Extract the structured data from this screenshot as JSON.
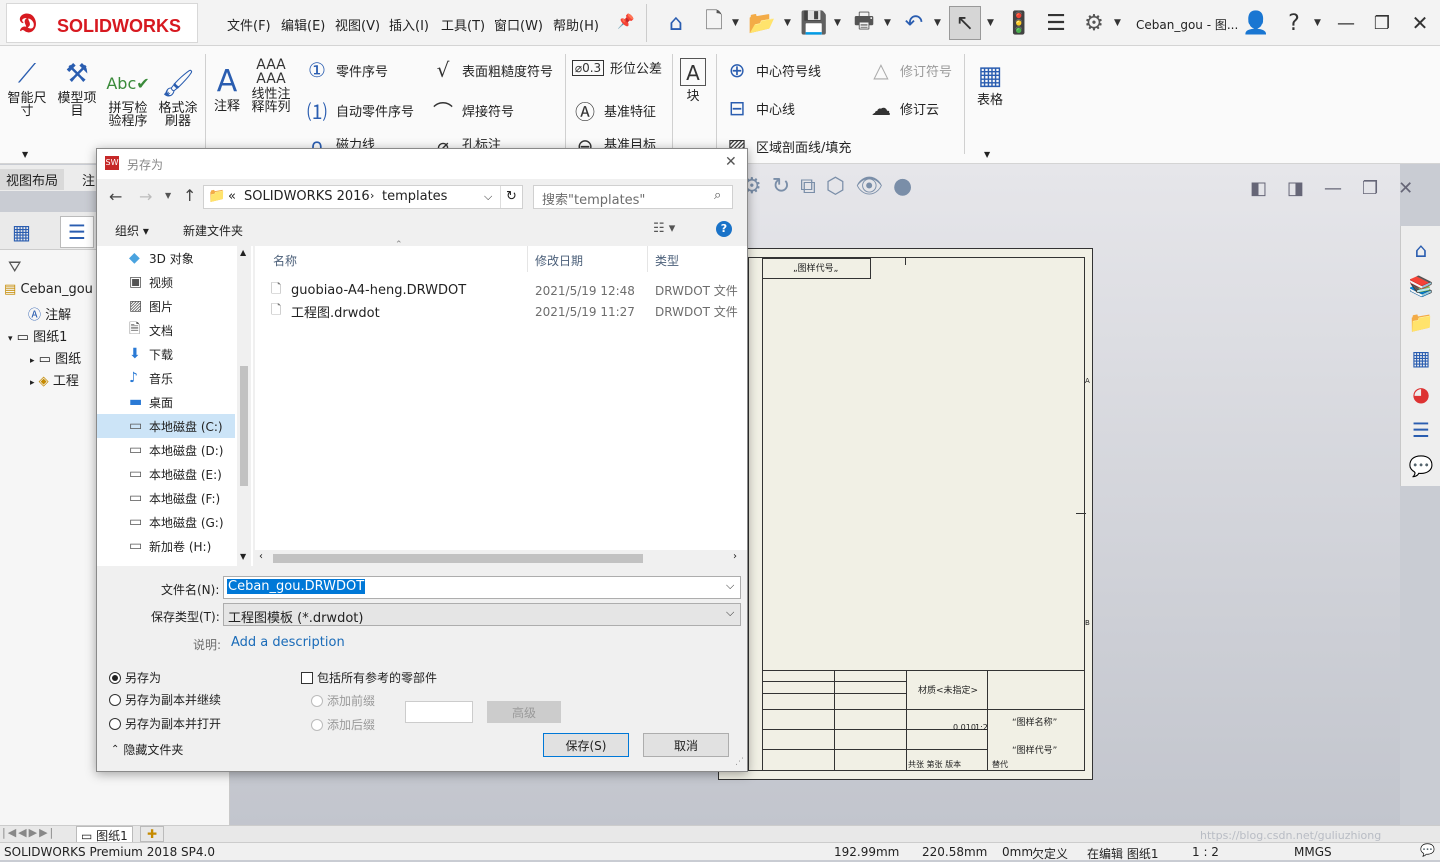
{
  "app": {
    "logo_text": "SOLIDWORKS",
    "window_title": "Ceban_gou - 图...",
    "menu": [
      "文件(F)",
      "编辑(E)",
      "视图(V)",
      "插入(I)",
      "工具(T)",
      "窗口(W)",
      "帮助(H)"
    ]
  },
  "ribbon": {
    "smart_dim": "智能尺寸",
    "model_items": "模型项目",
    "spell_check": "拼写检验程序",
    "format_painter": "格式涂刷器",
    "note": "注释",
    "linear_note": "线性注释阵列",
    "balloon": "零件序号",
    "auto_balloon": "自动零件序号",
    "magnetic_line": "磁力线",
    "surface_finish": "表面粗糙度符号",
    "weld_symbol": "焊接符号",
    "hole_callout": "孔标注",
    "gdt": "形位公差",
    "datum_feature": "基准特征",
    "datum_target": "基准目标",
    "block": "块",
    "centermark": "中心符号线",
    "centerline": "中心线",
    "area_hatch": "区域剖面线/填充",
    "revision_symbol": "修订符号",
    "revision_cloud": "修订云",
    "table": "表格"
  },
  "tabs": [
    "视图布局",
    "注"
  ],
  "tree": {
    "root": "Ceban_gou",
    "annotations": "注解",
    "sheet": "图纸1",
    "sheet_format": "图纸",
    "drawing_view": "工程"
  },
  "sheet": {
    "top_label": "„图样代号„",
    "material": "材质<未指定>",
    "drawing_name": "“图样名称”",
    "drawing_code": "“图样代号”",
    "scale_cells": [
      "0.010",
      "1:2"
    ],
    "zone_a": "A",
    "zone_b": "B",
    "signature_row": "共张 第张 版本",
    "rev_label": "替代"
  },
  "dialog": {
    "title": "另存为",
    "breadcrumb": [
      "SOLIDWORKS 2016",
      "templates"
    ],
    "search_placeholder": "搜索\"templates\"",
    "organize": "组织",
    "new_folder": "新建文件夹",
    "nav_items": [
      "3D 对象",
      "视频",
      "图片",
      "文档",
      "下载",
      "音乐",
      "桌面",
      "本地磁盘 (C:)",
      "本地磁盘 (D:)",
      "本地磁盘 (E:)",
      "本地磁盘 (F:)",
      "本地磁盘 (G:)",
      "新加卷 (H:)"
    ],
    "columns": {
      "name": "名称",
      "date": "修改日期",
      "type": "类型"
    },
    "files": [
      {
        "name": "guobiao-A4-heng.DRWDOT",
        "date": "2021/5/19 12:48",
        "type": "DRWDOT 文件"
      },
      {
        "name": "工程图.drwdot",
        "date": "2021/5/19 11:27",
        "type": "DRWDOT 文件"
      }
    ],
    "filename_label": "文件名(N):",
    "filename_value": "Ceban_gou.DRWDOT",
    "filetype_label": "保存类型(T):",
    "filetype_value": "工程图模板 (*.drwdot)",
    "desc_label": "说明:",
    "desc_value": "Add a description",
    "opt_save_as": "另存为",
    "opt_save_copy_continue": "另存为副本并继续",
    "opt_save_copy_open": "另存为副本并打开",
    "include_refs": "包括所有参考的零部件",
    "add_prefix": "添加前缀",
    "add_suffix": "添加后缀",
    "advanced": "高级",
    "hide_folders": "隐藏文件夹",
    "save": "保存(S)",
    "cancel": "取消"
  },
  "sheet_tab": "图纸1",
  "status": {
    "product": "SOLIDWORKS Premium 2018 SP4.0",
    "x": "192.99mm",
    "y": "220.58mm",
    "z": "0mm",
    "defined": "欠定义",
    "editing": "在编辑 图纸1",
    "scale": "1 : 2",
    "units": "MMGS",
    "watermark": "https://blog.csdn.net/guliuzhiong"
  },
  "colors": {
    "brand": "#d71920",
    "accent": "#2a5db0",
    "selection": "#0078d7"
  }
}
